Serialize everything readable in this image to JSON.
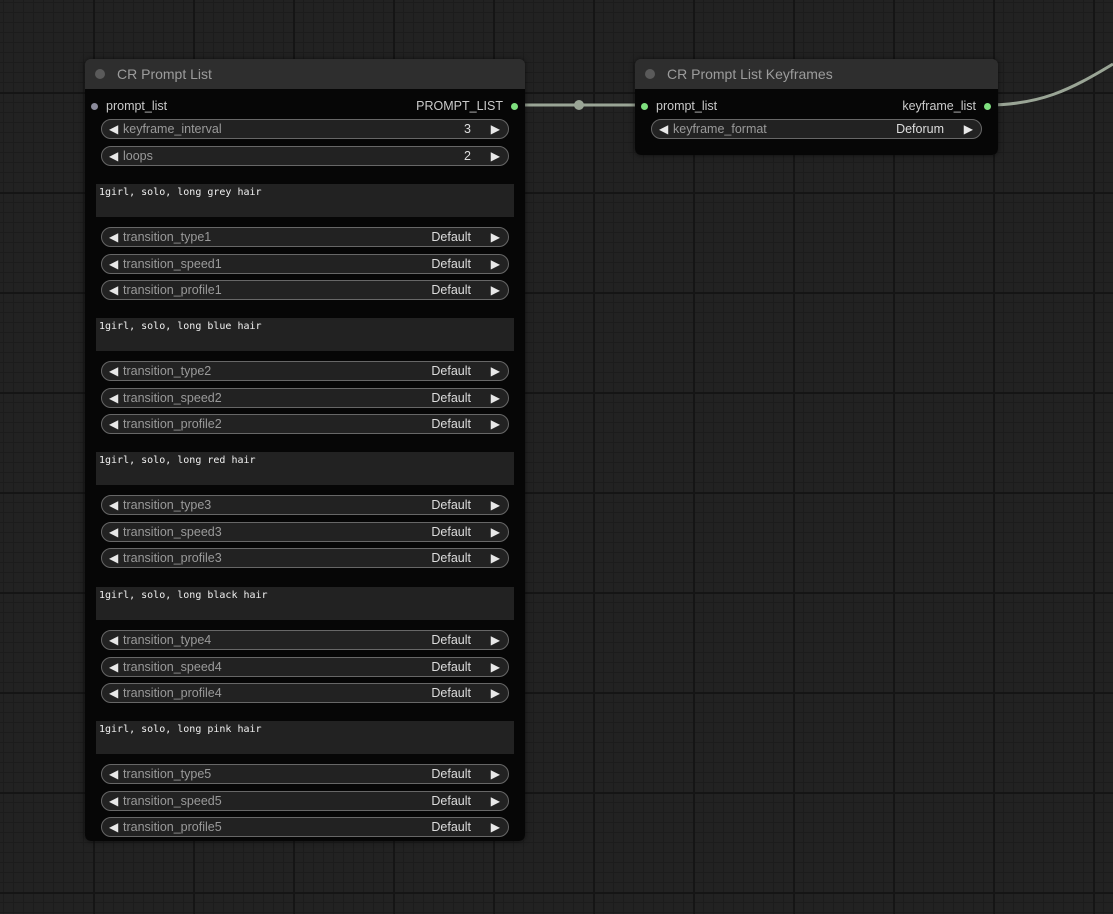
{
  "colors": {
    "background": "#222222",
    "link": "#9aa596",
    "slot_connected": "#7fe07f",
    "slot_unconnected": "#8a8a9a"
  },
  "node_prompt_list": {
    "title": "CR Prompt List",
    "input_slot": "prompt_list",
    "output_slot": "PROMPT_LIST",
    "top_widgets": [
      {
        "name": "keyframe_interval",
        "value": "3"
      },
      {
        "name": "loops",
        "value": "2"
      }
    ],
    "prompts": [
      {
        "text": "1girl, solo, long grey hair",
        "widgets": [
          {
            "name": "transition_type1",
            "value": "Default"
          },
          {
            "name": "transition_speed1",
            "value": "Default"
          },
          {
            "name": "transition_profile1",
            "value": "Default"
          }
        ]
      },
      {
        "text": "1girl, solo, long blue hair",
        "widgets": [
          {
            "name": "transition_type2",
            "value": "Default"
          },
          {
            "name": "transition_speed2",
            "value": "Default"
          },
          {
            "name": "transition_profile2",
            "value": "Default"
          }
        ]
      },
      {
        "text": "1girl, solo, long red hair",
        "widgets": [
          {
            "name": "transition_type3",
            "value": "Default"
          },
          {
            "name": "transition_speed3",
            "value": "Default"
          },
          {
            "name": "transition_profile3",
            "value": "Default"
          }
        ]
      },
      {
        "text": "1girl, solo, long black hair",
        "widgets": [
          {
            "name": "transition_type4",
            "value": "Default"
          },
          {
            "name": "transition_speed4",
            "value": "Default"
          },
          {
            "name": "transition_profile4",
            "value": "Default"
          }
        ]
      },
      {
        "text": "1girl, solo, long pink hair",
        "widgets": [
          {
            "name": "transition_type5",
            "value": "Default"
          },
          {
            "name": "transition_speed5",
            "value": "Default"
          },
          {
            "name": "transition_profile5",
            "value": "Default"
          }
        ]
      }
    ]
  },
  "node_keyframes": {
    "title": "CR Prompt List Keyframes",
    "input_slot": "prompt_list",
    "output_slot": "keyframe_list",
    "widgets": [
      {
        "name": "keyframe_format",
        "value": "Deforum"
      }
    ]
  },
  "icons": {
    "arrow_left": "◀",
    "arrow_right": "▶"
  }
}
